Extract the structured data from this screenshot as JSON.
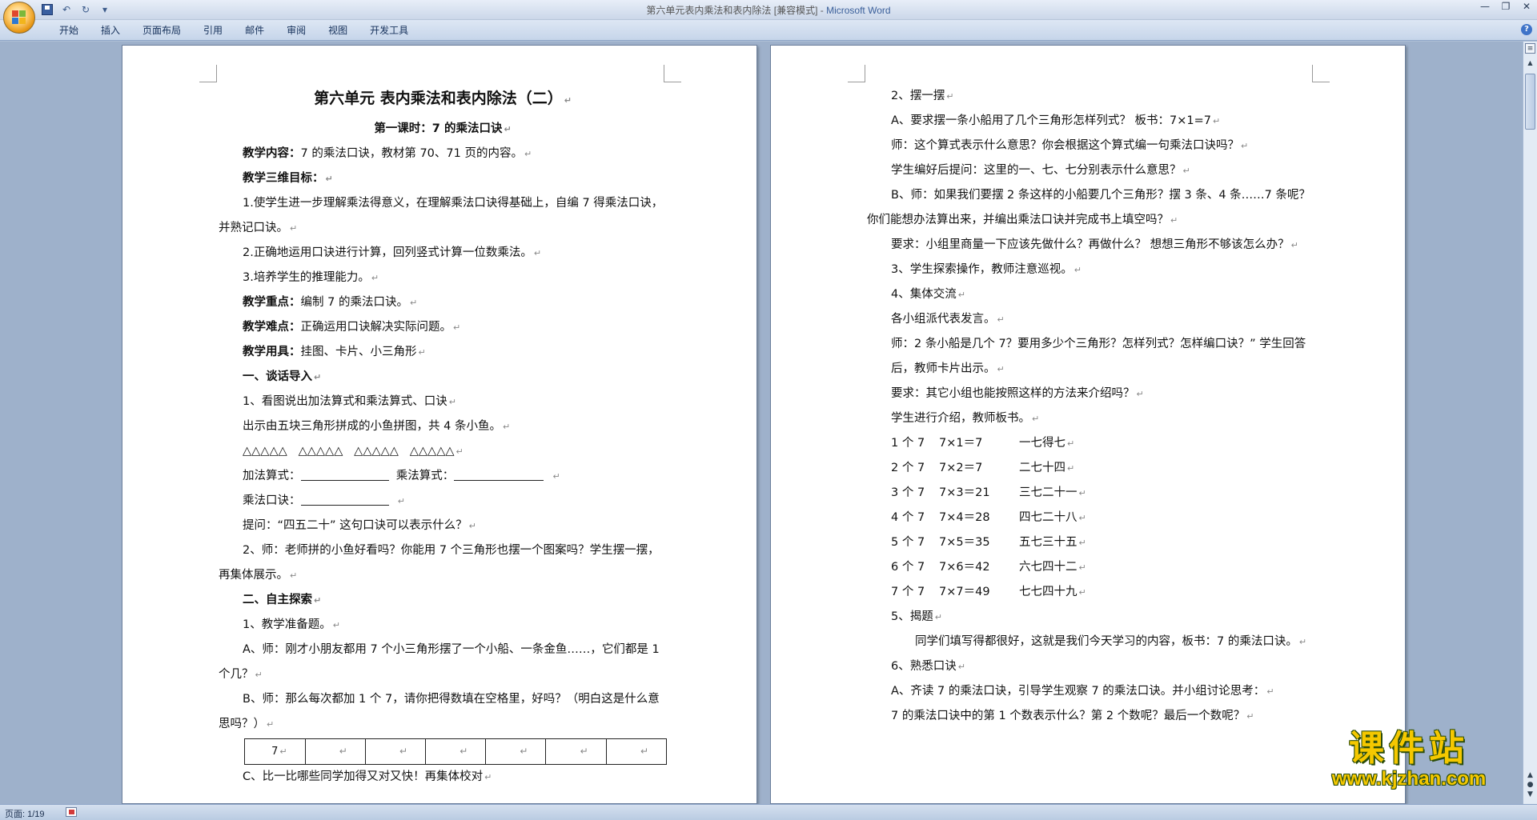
{
  "window": {
    "title_doc": "第六单元表内乘法和表内除法 [兼容模式] - ",
    "title_app": "Microsoft Word",
    "minimize": "—",
    "restore": "❐",
    "close": "✕"
  },
  "qat": {
    "dropdown": "▾"
  },
  "ribbon": {
    "tabs": [
      "开始",
      "插入",
      "页面布局",
      "引用",
      "邮件",
      "审阅",
      "视图",
      "开发工具"
    ],
    "help": "?"
  },
  "page_left": {
    "title": "第六单元   表内乘法和表内除法（二）",
    "subtitle": "第一课时：7 的乘法口诀",
    "content_label": "教学内容：",
    "content_text": "7 的乘法口诀，教材第 70、71 页的内容。",
    "goals_label": "教学三维目标：",
    "goal1": "1.使学生进一步理解乘法得意义，在理解乘法口诀得基础上，自编 7 得乘法口诀，并熟记口诀。",
    "goal2": "2.正确地运用口诀进行计算，回列竖式计算一位数乘法。",
    "goal3": "3.培养学生的推理能力。",
    "key_label": "教学重点：",
    "key_text": "编制 7 的乘法口诀。",
    "diff_label": "教学难点：",
    "diff_text": "正确运用口诀解决实际问题。",
    "tools_label": "教学用具：",
    "tools_text": "挂图、卡片、小三角形",
    "sec1": "一、谈话导入",
    "s1_1": "1、看图说出加法算式和乘法算式、口诀",
    "s1_2": "出示由五块三角形拼成的小鱼拼图，共 4 条小鱼。",
    "triangles": "△△△△△   △△△△△   △△△△△   △△△△△",
    "add_label": "加法算式：",
    "mul_label": "乘法算式：",
    "rule_label": "乘法口诀：",
    "q1": "提问：“四五二十” 这句口诀可以表示什么？",
    "s1_3": "2、师：老师拼的小鱼好看吗？你能用 7 个三角形也摆一个图案吗？学生摆一摆，再集体展示。",
    "sec2": "二、自主探索",
    "s2_1": "1、教学准备题。",
    "s2_a": "A、师：刚才小朋友都用 7 个小三角形摆了一个小船、一条金鱼……，它们都是 1 个几？",
    "s2_b": "B、师：那么每次都加 1 个 7，请你把得数填在空格里，好吗？（明白这是什么意思吗？）",
    "table_first": "7",
    "table_marks": [
      "↵",
      "↵",
      "↵",
      "↵",
      "↵",
      "↵"
    ],
    "s2_c": "C、比一比哪些同学加得又对又快！再集体校对"
  },
  "page_right": {
    "r1": "2、摆一摆",
    "r2": "A、要求摆一条小船用了几个三角形怎样列式？   板书：7×1=7",
    "r3": "师：这个算式表示什么意思？你会根据这个算式编一句乘法口诀吗？",
    "r4": "学生编好后提问：这里的一、七、七分别表示什么意思？",
    "r5": "B、师：如果我们要摆 2 条这样的小船要几个三角形？摆 3 条、4 条……7 条呢？你们能想办法算出来，并编出乘法口诀并完成书上填空吗？",
    "r6": "要求：小组里商量一下应该先做什么？再做什么？  想想三角形不够该怎么办？",
    "r7": "3、学生探索操作，教师注意巡视。",
    "r8": "4、集体交流",
    "r9": "各小组派代表发言。",
    "r10": "师：2 条小船是几个 7？要用多少个三角形？怎样列式？怎样编口诀？” 学生回答后，教师卡片出示。",
    "r11": "要求：其它小组也能按照这样的方法来介绍吗？",
    "r12": "学生进行介绍，教师板书。",
    "rules": [
      {
        "count": "1 个 7",
        "eq": "7×1＝7",
        "verse": "一七得七"
      },
      {
        "count": "2 个 7",
        "eq": "7×2＝7",
        "verse": "二七十四"
      },
      {
        "count": "3 个 7",
        "eq": "7×3＝21",
        "verse": "三七二十一"
      },
      {
        "count": "4 个 7",
        "eq": "7×4＝28",
        "verse": "四七二十八"
      },
      {
        "count": "5 个 7",
        "eq": "7×5＝35",
        "verse": "五七三十五"
      },
      {
        "count": "6 个 7",
        "eq": "7×6＝42",
        "verse": "六七四十二"
      },
      {
        "count": "7 个 7",
        "eq": "7×7＝49",
        "verse": "七七四十九"
      }
    ],
    "r13": "5、揭题",
    "r14": "同学们填写得都很好，这就是我们今天学习的内容，板书：7 的乘法口诀。",
    "r15": "6、熟悉口诀",
    "r16": "A、齐读 7 的乘法口诀，引导学生观察 7 的乘法口诀。并小组讨论思考：",
    "r17": "7 的乘法口诀中的第 1 个数表示什么？第 2 个数呢？最后一个数呢？"
  },
  "paragraph_mark": "↵",
  "scrollbar": {
    "up": "▲",
    "prev": "▲",
    "select": "●",
    "next": "▼",
    "ruler": "≡"
  },
  "status": {
    "page": "页面: 1/19"
  },
  "watermark": {
    "text": "课件站",
    "url": "www.kjzhan.com"
  }
}
